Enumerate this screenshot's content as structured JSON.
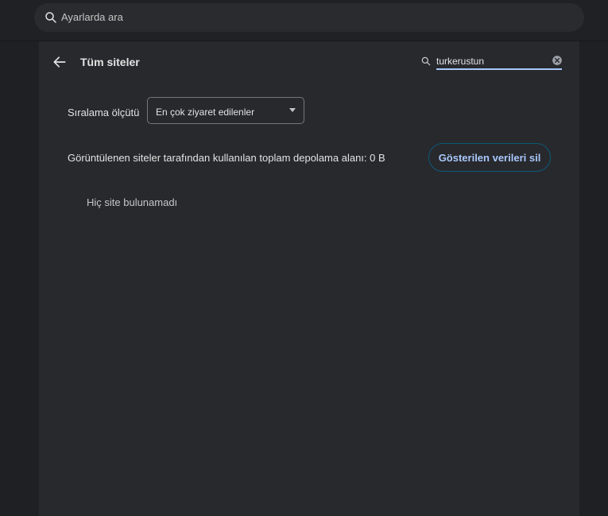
{
  "topbar": {
    "search_placeholder": "Ayarlarda ara",
    "search_icon": "search-icon"
  },
  "header": {
    "title": "Tüm siteler",
    "back_icon": "back-arrow-icon",
    "site_search_value": "turkerustun",
    "site_search_icon": "search-icon",
    "clear_icon": "clear-icon"
  },
  "sort": {
    "label": "Sıralama ölçütü",
    "selected": "En çok ziyaret edilenler"
  },
  "storage": {
    "text": "Görüntülenen siteler tarafından kullanılan toplam depolama alanı: 0 B",
    "delete_button_label": "Gösterilen verileri sil"
  },
  "results": {
    "empty_message": "Hiç site bulunamadı"
  },
  "colors": {
    "background": "#1f2023",
    "card": "#28292d",
    "accent": "#a8c7fa",
    "button_border": "#0b5a7a"
  }
}
